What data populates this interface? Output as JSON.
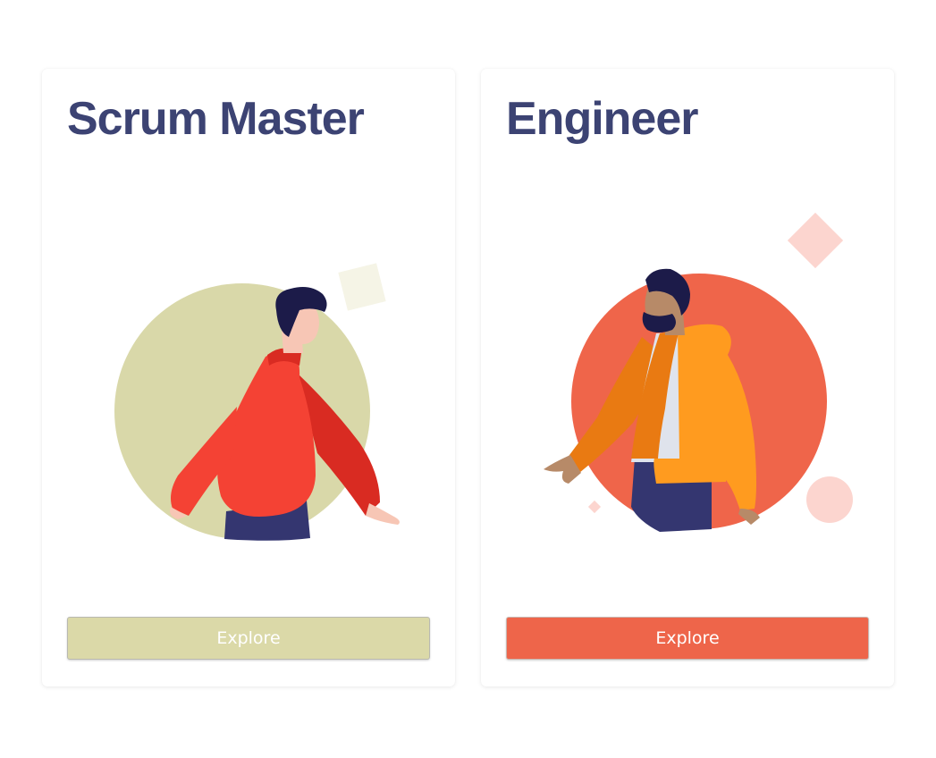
{
  "cards": [
    {
      "title": "Scrum Master",
      "button_label": "Explore",
      "accent_color": "#dbd9a8",
      "icon": "person-red-sweater-illustration"
    },
    {
      "title": "Engineer",
      "button_label": "Explore",
      "accent_color": "#ee654a",
      "icon": "person-orange-jacket-illustration"
    }
  ],
  "colors": {
    "title": "#3c4373",
    "page_background": "#ffffff",
    "card_background": "#ffffff"
  }
}
